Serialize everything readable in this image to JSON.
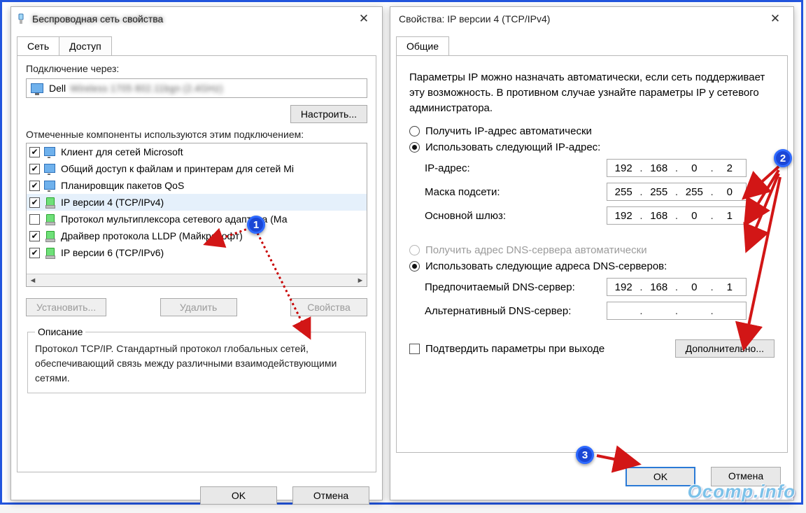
{
  "left": {
    "title_visible": "",
    "tabs": {
      "network": "Сеть",
      "access": "Доступ"
    },
    "connect_via_label": "Подключение через:",
    "adapter_name": "Dell",
    "configure_btn": "Настроить...",
    "components_label": "Отмеченные компоненты используются этим подключением:",
    "items": [
      {
        "checked": true,
        "icon": "n1",
        "text": "Клиент для сетей Microsoft"
      },
      {
        "checked": true,
        "icon": "n2",
        "text": "Общий доступ к файлам и принтерам для сетей Mi"
      },
      {
        "checked": true,
        "icon": "n3",
        "text": "Планировщик пакетов QoS"
      },
      {
        "checked": true,
        "icon": "n4",
        "text": "IP версии 4 (TCP/IPv4)"
      },
      {
        "checked": false,
        "icon": "n4",
        "text": "Протокол мультиплексора сетевого адаптера (Ма"
      },
      {
        "checked": true,
        "icon": "n4",
        "text": "Драйвер протокола LLDP (Майкрософт)"
      },
      {
        "checked": true,
        "icon": "n4",
        "text": "IP версии 6 (TCP/IPv6)"
      }
    ],
    "install_btn": "Установить...",
    "remove_btn": "Удалить",
    "properties_btn": "Свойства",
    "desc_legend": "Описание",
    "desc_text": "Протокол TCP/IP. Стандартный протокол глобальных сетей, обеспечивающий связь между различными взаимодействующими сетями.",
    "ok_btn": "OK",
    "cancel_btn": "Отмена"
  },
  "right": {
    "title": "Свойства: IP версии 4 (TCP/IPv4)",
    "tab": "Общие",
    "help_text": "Параметры IP можно назначать автоматически, если сеть поддерживает эту возможность. В противном случае узнайте параметры IP у сетевого администратора.",
    "auto_ip": "Получить IP-адрес автоматически",
    "manual_ip": "Использовать следующий IP-адрес:",
    "ip_label": "IP-адрес:",
    "ip_value": [
      "192",
      "168",
      "0",
      "2"
    ],
    "mask_label": "Маска подсети:",
    "mask_value": [
      "255",
      "255",
      "255",
      "0"
    ],
    "gw_label": "Основной шлюз:",
    "gw_value": [
      "192",
      "168",
      "0",
      "1"
    ],
    "auto_dns": "Получить адрес DNS-сервера автоматически",
    "manual_dns": "Использовать следующие адреса DNS-серверов:",
    "dns1_label": "Предпочитаемый DNS-сервер:",
    "dns1_value": [
      "192",
      "168",
      "0",
      "1"
    ],
    "dns2_label": "Альтернативный DNS-сервер:",
    "dns2_value": [
      "",
      "",
      "",
      ""
    ],
    "confirm_exit": "Подтвердить параметры при выходе",
    "advanced_btn": "Дополнительно...",
    "ok_btn": "OK",
    "cancel_btn": "Отмена"
  },
  "annotations": {
    "b1": "1",
    "b2": "2",
    "b3": "3"
  },
  "watermark": "Ocomp.info"
}
